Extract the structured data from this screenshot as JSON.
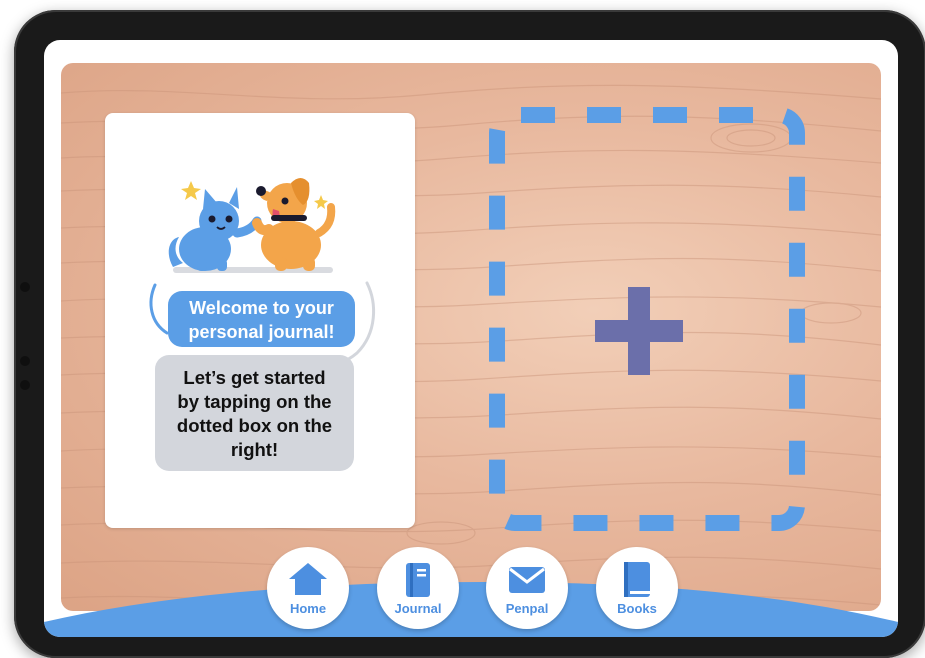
{
  "colors": {
    "accent_blue": "#5b9ee6",
    "plus_purple": "#6b6faa",
    "card_bubble_grey": "#d3d6dc",
    "wood": "#e8b89e"
  },
  "welcome_card": {
    "title": "Welcome to your personal journal!",
    "title_line1": "Welcome to your",
    "title_line2": "personal journal!",
    "instruction_line1": "Let’s get started",
    "instruction_line2": "by tapping on the",
    "instruction_line3": "dotted box on the",
    "instruction_line4": "right!",
    "illustration": "cat-and-dog-high-five"
  },
  "dropzone": {
    "icon": "plus-icon"
  },
  "nav": {
    "items": [
      {
        "label": "Home",
        "icon": "home-icon"
      },
      {
        "label": "Journal",
        "icon": "journal-icon"
      },
      {
        "label": "Penpal",
        "icon": "envelope-icon"
      },
      {
        "label": "Books",
        "icon": "book-icon"
      }
    ]
  }
}
